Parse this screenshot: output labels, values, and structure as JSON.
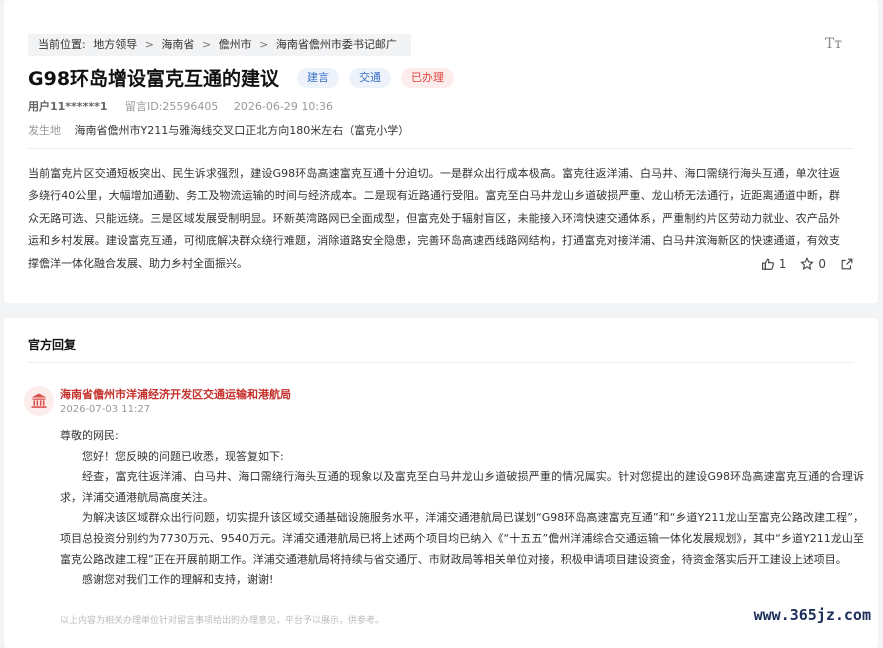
{
  "breadcrumb": {
    "prefix": "当前位置:",
    "items": [
      "地方领导",
      "海南省",
      "儋州市",
      "海南省儋州市委书记邮广"
    ],
    "separator": ">"
  },
  "font_button": "Tт",
  "message": {
    "title": "G98环岛增设富克互通的建议",
    "tags": [
      "建言",
      "交通",
      "已办理"
    ],
    "user": "用户11******1",
    "message_id": "留言ID:25596405",
    "date": "2026-06-29 10:36",
    "place_label": "发生地",
    "place": "海南省儋州市Y211与雅海线交叉口正北方向180米左右（富克小学）",
    "body": "当前富克片区交通短板突出、民生诉求强烈，建设G98环岛高速富克互通十分迫切。一是群众出行成本极高。富克往返洋浦、白马井、海口需绕行海头互通，单次往返多绕行40公里，大幅增加通勤、务工及物流运输的时间与经济成本。二是现有近路通行受阻。富克至白马井龙山乡道破损严重、龙山桥无法通行，近距离通道中断，群众无路可选、只能远绕。三是区域发展受制明显。环新英湾路网已全面成型，但富克处于辐射盲区，未能接入环湾快速交通体系，严重制约片区劳动力就业、农产品外运和乡村发展。建设富克互通，可彻底解决群众绕行难题，消除道路安全隐患，完善环岛高速西线路网结构，打通富克对接洋浦、白马井滨海新区的快速通道，有效支撑儋洋一体化融合发展、助力乡村全面振兴。",
    "likes": "1",
    "stars": "0"
  },
  "reply": {
    "heading": "官方回复",
    "org": "海南省儋州市洋浦经济开发区交通运输和港航局",
    "time": "2026-07-03 11:27",
    "greeting": "尊敬的网民:",
    "p1": "您好！您反映的问题已收悉，现答复如下:",
    "p2": "经查，富克往返洋浦、白马井、海口需绕行海头互通的现象以及富克至白马井龙山乡道破损严重的情况属实。针对您提出的建设G98环岛高速富克互通的合理诉求，洋浦交通港航局高度关注。",
    "p3": "为解决该区域群众出行问题，切实提升该区域交通基础设施服务水平，洋浦交通港航局已谋划“G98环岛高速富克互通”和“乡道Y211龙山至富克公路改建工程”，项目总投资分别约为7730万元、9540万元。洋浦交通港航局已将上述两个项目均已纳入《“十五五”儋州洋浦综合交通运输一体化发展规划》，其中“乡道Y211龙山至富克公路改建工程”正在开展前期工作。洋浦交通港航局将持续与省交通厅、市财政局等相关单位对接，积极申请项目建设资金，待资金落实后开工建设上述项目。",
    "p4": "感谢您对我们工作的理解和支持，谢谢!",
    "note": "以上内容为相关办理单位针对留言事项给出的办理意见，平台予以展示，供参考。"
  },
  "watermark": "www.365jz.com"
}
